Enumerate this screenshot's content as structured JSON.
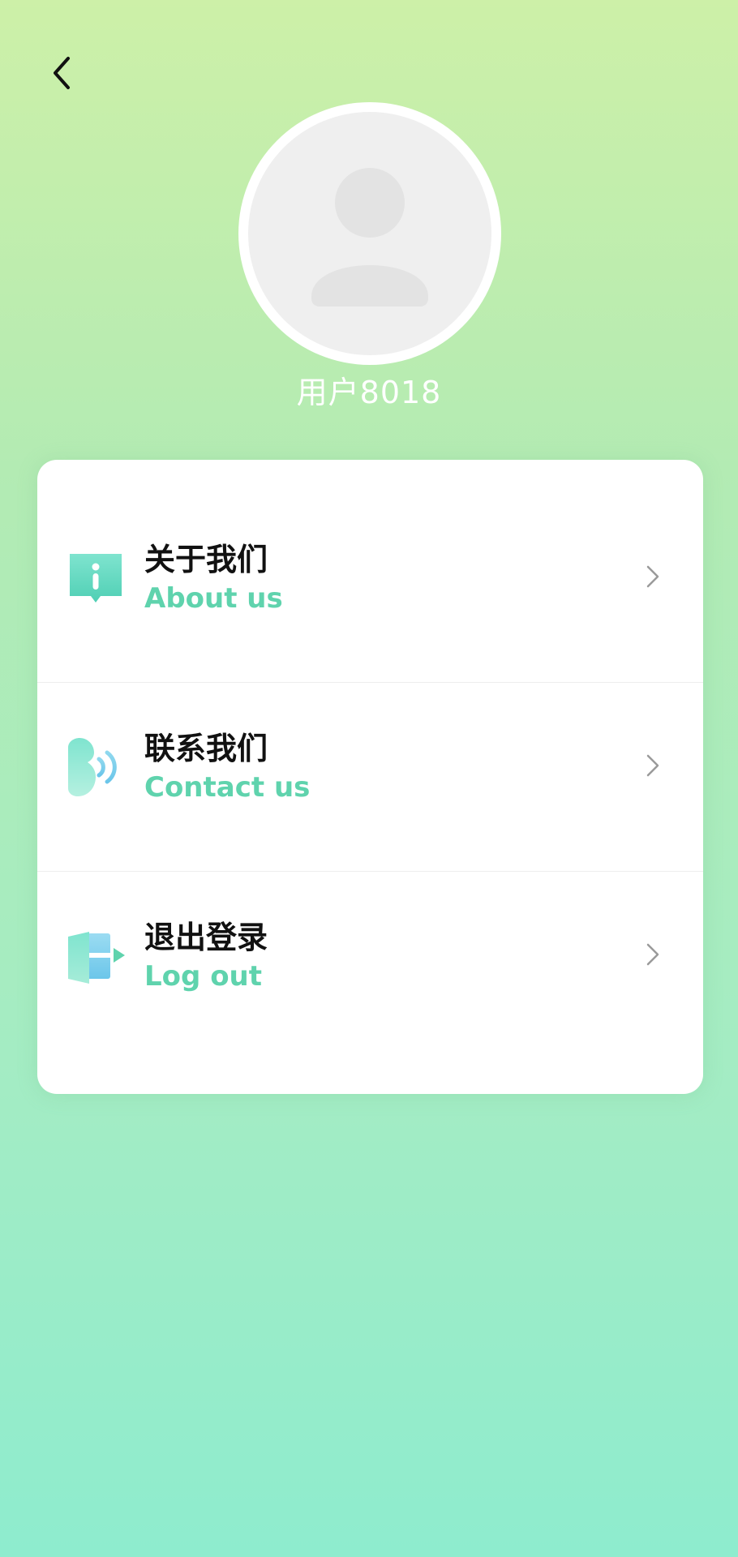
{
  "header": {
    "back_icon": "chevron-left-icon"
  },
  "profile": {
    "avatar_icon": "default-user-avatar",
    "username": "用户8018"
  },
  "menu": {
    "items": [
      {
        "icon": "info-icon",
        "title": "关于我们",
        "subtitle": "About us",
        "arrow_icon": "chevron-right-icon"
      },
      {
        "icon": "contact-icon",
        "title": "联系我们",
        "subtitle": "Contact us",
        "arrow_icon": "chevron-right-icon"
      },
      {
        "icon": "logout-icon",
        "title": "退出登录",
        "subtitle": "Log out",
        "arrow_icon": "chevron-right-icon"
      }
    ]
  },
  "colors": {
    "accent": "#5fd3ad",
    "title_text": "#111111",
    "username_text": "#ffffff",
    "background_top": "#cdf0a8",
    "background_bottom": "#8eecce",
    "card": "#ffffff"
  }
}
